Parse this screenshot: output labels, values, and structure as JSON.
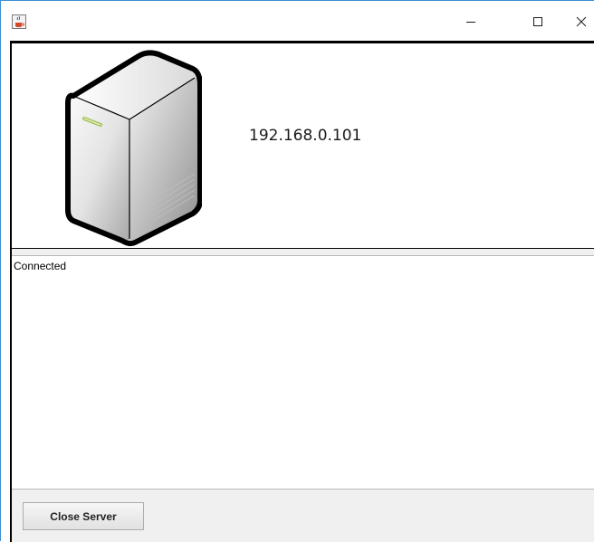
{
  "window": {
    "title": "",
    "icons": {
      "app": "java-cup-icon",
      "minimize": "minimize-icon",
      "maximize": "maximize-icon",
      "close": "close-icon"
    }
  },
  "server": {
    "image": "server-tower-icon",
    "address": "192.168.0.101"
  },
  "log": {
    "lines": [
      "Connected"
    ]
  },
  "actions": {
    "close_server_label": "Close Server"
  },
  "colors": {
    "window_border": "#3a8fd6",
    "panel_background": "#f0f0f0",
    "content_background": "#ffffff"
  }
}
